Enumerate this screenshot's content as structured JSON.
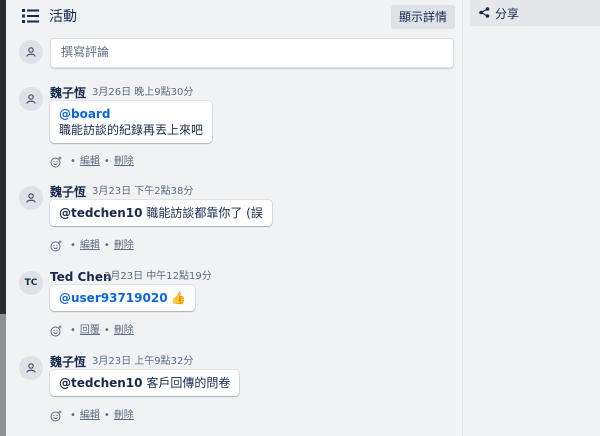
{
  "header": {
    "title": "活動",
    "details_button": "顯示詳情"
  },
  "share": {
    "label": "分享"
  },
  "comment_box": {
    "placeholder": "撰寫評論"
  },
  "activities": [
    {
      "author": "魏子恆",
      "time": "3月26日 晚上9點30分",
      "mention": "@board",
      "text": "職能訪談的紀錄再丟上來吧",
      "actions": [
        "編輯",
        "刪除"
      ]
    },
    {
      "author": "魏子恆",
      "time": "3月23日 下午2點38分",
      "mention": "@tedchen10",
      "text": " 職能訪談都靠你了 (誤",
      "actions": [
        "編輯",
        "刪除"
      ]
    },
    {
      "author": "Ted Chen",
      "initials": "TC",
      "time": "3月23日 中午12點19分",
      "mention": "@user93719020",
      "text": " 👍",
      "actions": [
        "回覆",
        "刪除"
      ]
    },
    {
      "author": "魏子恆",
      "time": "3月23日 上午9點32分",
      "mention": "@tedchen10",
      "text": " 客戶回傳的問卷",
      "actions": [
        "編輯",
        "刪除"
      ]
    }
  ],
  "colors": {
    "mention": "#0c66e4",
    "text": "#172b4d",
    "muted": "#5e6c84"
  }
}
